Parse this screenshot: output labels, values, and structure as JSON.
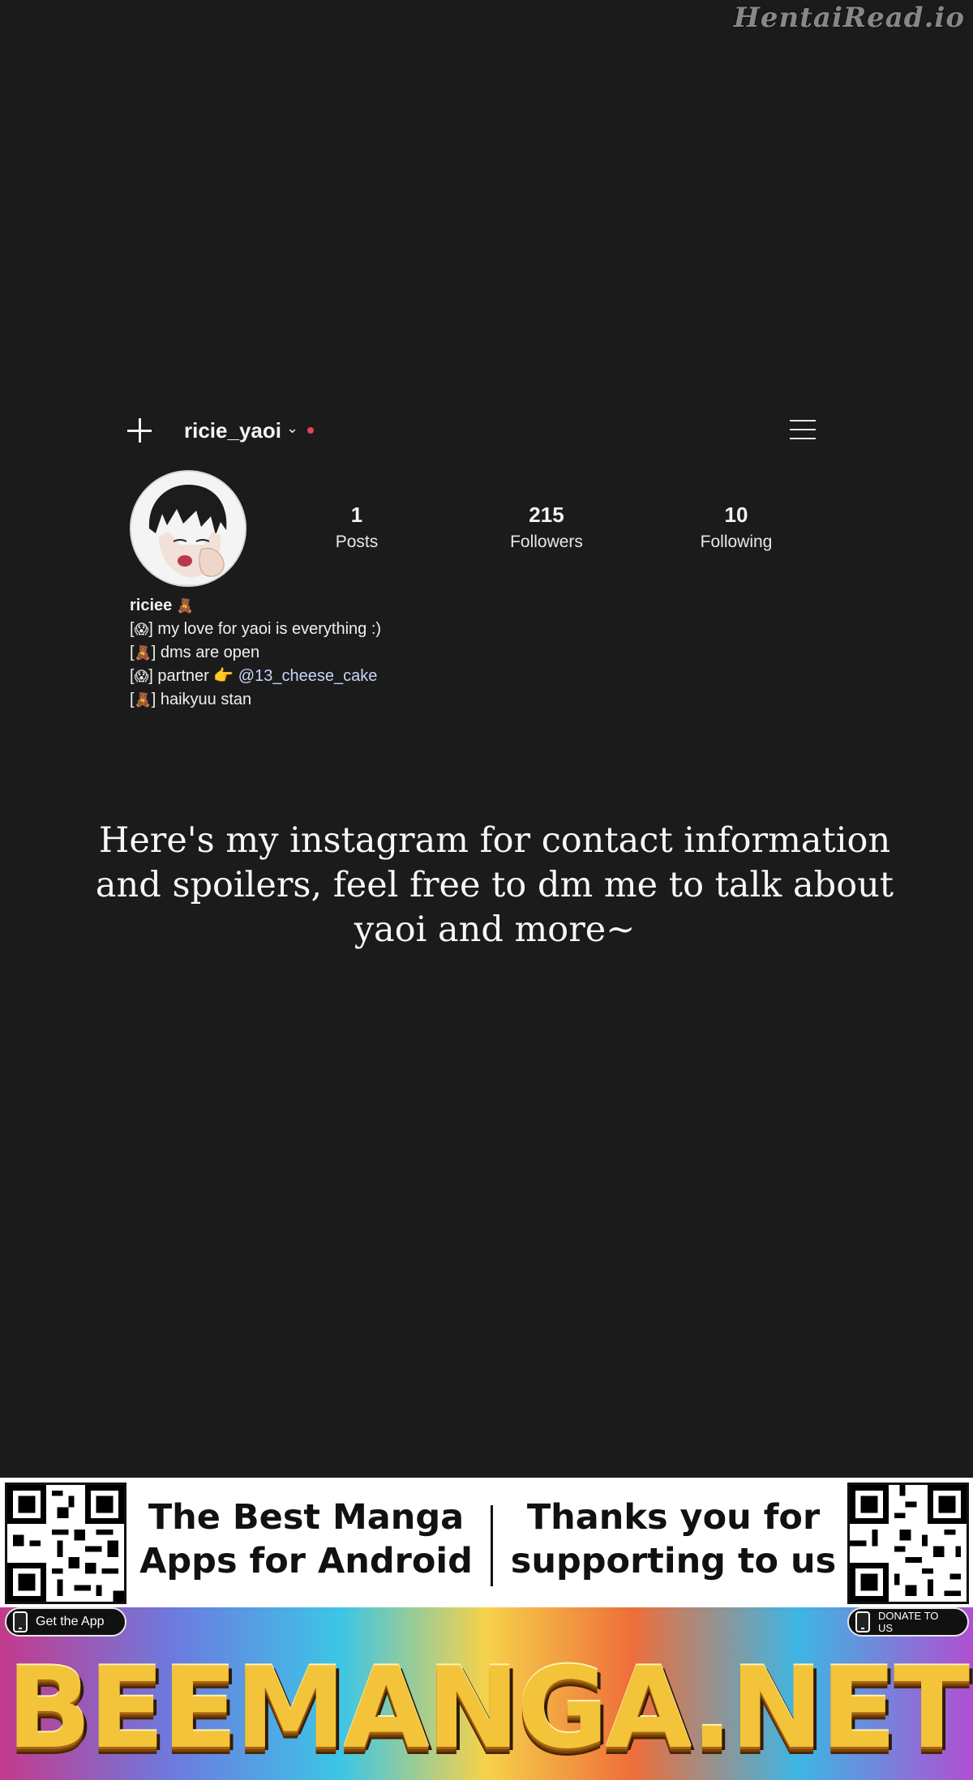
{
  "watermark": "HentaiRead.io",
  "profile": {
    "username": "ricie_yaoi",
    "stats": [
      {
        "value": "1",
        "label": "Posts"
      },
      {
        "value": "215",
        "label": "Followers"
      },
      {
        "value": "10",
        "label": "Following"
      }
    ],
    "bio": {
      "name": "riciee",
      "name_emoji": "🧸",
      "lines": [
        {
          "prefix": "[",
          "emoji": "😱",
          "suffix": "] my love for yaoi is everything :)"
        },
        {
          "prefix": "[",
          "emoji": "🧸",
          "suffix": "] dms are open"
        },
        {
          "prefix": "[",
          "emoji": "😱",
          "suffix": "] partner 👉 ",
          "mention": "@13_cheese_cake"
        },
        {
          "prefix": "[",
          "emoji": "🧸",
          "suffix": "] haikyuu stan"
        }
      ]
    },
    "icons": {
      "add": "plus-icon",
      "dropdown": "chevron-down-icon",
      "menu": "hamburger-menu-icon"
    },
    "live_dot_color": "#e0455a"
  },
  "note": "Here's my instagram for contact information and spoilers, feel free to dm me to talk about yaoi and more~",
  "banner": {
    "left_text": [
      "The Best Manga",
      "Apps for Android"
    ],
    "right_text": [
      "Thanks you for",
      "supporting to us"
    ],
    "get_app_label": "Get the App",
    "donate_label": "DONATE TO US",
    "brand": "BEEMANGA.NET"
  }
}
